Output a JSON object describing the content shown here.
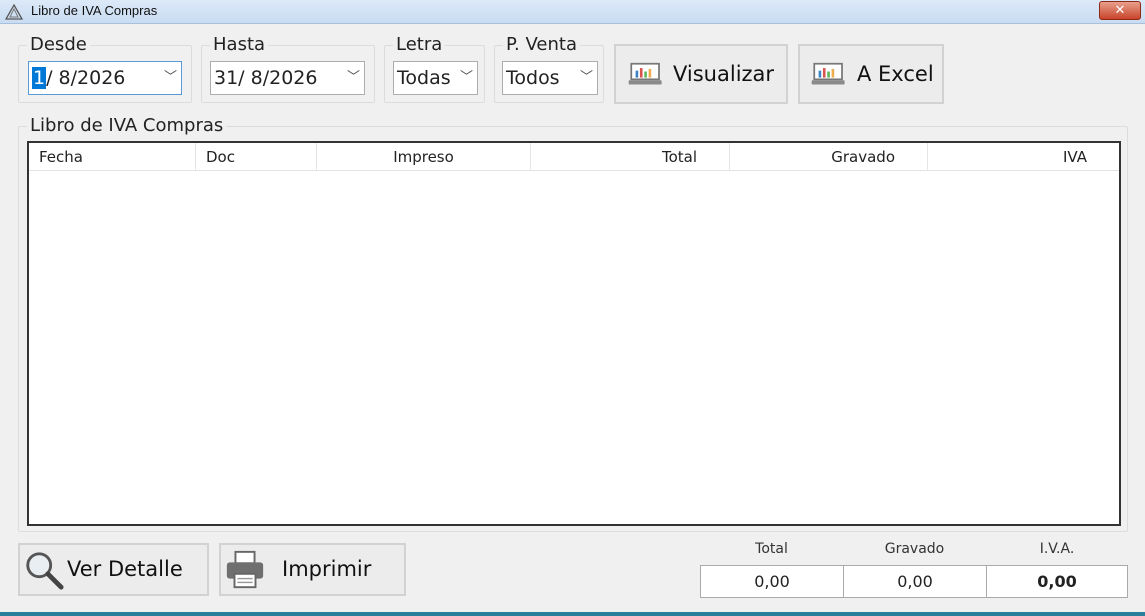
{
  "window": {
    "title": "Libro de IVA Compras",
    "close_label": "✕"
  },
  "filters": {
    "desde": {
      "label": "Desde",
      "value_selected": "1",
      "value_rest": "/  8/2026"
    },
    "hasta": {
      "label": "Hasta",
      "value": "31/  8/2026"
    },
    "letra": {
      "label": "Letra",
      "value": "Todas"
    },
    "pventa": {
      "label": "P. Venta",
      "value": "Todos"
    }
  },
  "buttons": {
    "visualizar": "Visualizar",
    "excel": "A Excel",
    "ver_detalle": "Ver Detalle",
    "imprimir": "Imprimir"
  },
  "list": {
    "title": "Libro de IVA Compras",
    "columns": [
      "Fecha",
      "Doc",
      "Impreso",
      "Total",
      "Gravado",
      "IVA"
    ],
    "rows": []
  },
  "totals": {
    "labels": {
      "total": "Total",
      "gravado": "Gravado",
      "iva": "I.V.A."
    },
    "values": {
      "total": "0,00",
      "gravado": "0,00",
      "iva": "0,00"
    }
  },
  "icons": {
    "app": "warning-triangle-icon",
    "visualizar": "chart-monitor-icon",
    "excel": "chart-monitor-icon",
    "ver_detalle": "magnifier-icon",
    "imprimir": "printer-icon"
  },
  "colors": {
    "selection": "#0078d7",
    "close": "#c8442a",
    "accent_bottom": "#2a7f9a"
  }
}
